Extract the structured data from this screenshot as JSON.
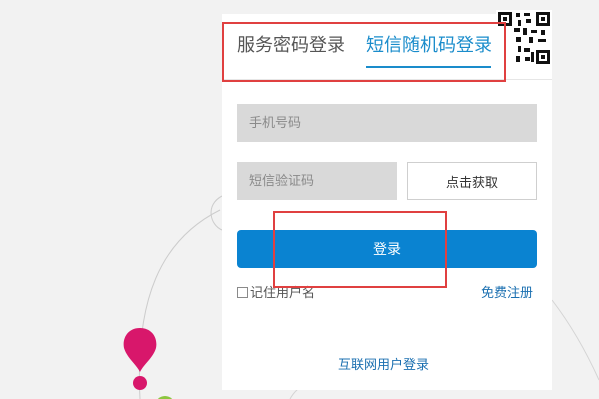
{
  "tabs": {
    "password_login": "服务密码登录",
    "sms_login": "短信随机码登录"
  },
  "form": {
    "phone_placeholder": "手机号码",
    "code_placeholder": "短信验证码",
    "get_code_label": "点击获取",
    "login_label": "登录",
    "remember_label": "记住用户名",
    "register_label": "免费注册",
    "internet_login_label": "互联网用户登录"
  },
  "colors": {
    "accent": "#1a8ccb",
    "login_button": "#0a83d1",
    "annotation_box": "#e04040",
    "pin_pink": "#d8176b",
    "pin_green": "#8cc63f"
  },
  "icons": {
    "qr": "qr-code-icon",
    "pin": "map-pin-icon"
  }
}
